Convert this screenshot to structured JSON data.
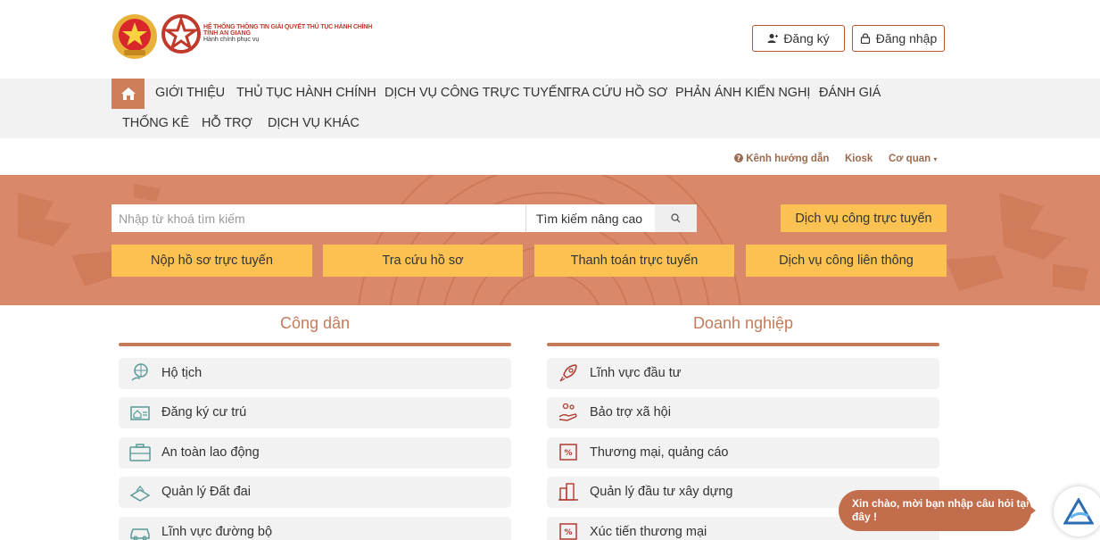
{
  "header": {
    "brand_line1": "HỆ THỐNG THÔNG TIN GIẢI QUYẾT THỦ TỤC HÀNH CHÍNH",
    "brand_line2": "TỈNH AN GIANG",
    "brand_line3": "Hành chính phục vụ",
    "register_label": "Đăng ký",
    "login_label": "Đăng nhập"
  },
  "nav": {
    "items": [
      "GIỚI THIỆU",
      "THỦ TỤC HÀNH CHÍNH",
      "DỊCH VỤ CÔNG TRỰC TUYẾN",
      "TRA CỨU HỒ SƠ",
      "PHẢN ÁNH KIẾN NGHỊ",
      "ĐÁNH GIÁ",
      "THỐNG KÊ",
      "HỖ TRỢ",
      "DỊCH VỤ KHÁC"
    ]
  },
  "sublinks": {
    "guide": "Kênh hướng dẫn",
    "kiosk": "Kiosk",
    "agency": "Cơ quan"
  },
  "search": {
    "placeholder": "Nhập từ khoá tìm kiếm",
    "advanced": "Tìm kiếm nâng cao",
    "online_service": "Dịch vụ công trực tuyến"
  },
  "actions": [
    "Nộp hồ sơ trực tuyến",
    "Tra cứu hồ sơ",
    "Thanh toán trực tuyến",
    "Dịch vụ công liên thông"
  ],
  "citizen": {
    "title": "Công dân",
    "items": [
      "Hộ tịch",
      "Đăng ký cư trú",
      "An toàn lao động",
      "Quản lý Đất đai",
      "Lĩnh vực đường bộ"
    ]
  },
  "business": {
    "title": "Doanh nghiệp",
    "items": [
      "Lĩnh vực đầu tư",
      "Bảo trợ xã hội",
      "Thương mại, quảng cáo",
      "Quản lý đầu tư xây dựng",
      "Xúc tiến thương mại"
    ]
  },
  "chat": {
    "text": "Xin chào, mời bạn nhập câu hỏi tại đây !"
  },
  "colors": {
    "accent": "#c37b5a",
    "banner": "#d9896a",
    "button_yellow": "#fcc251"
  }
}
